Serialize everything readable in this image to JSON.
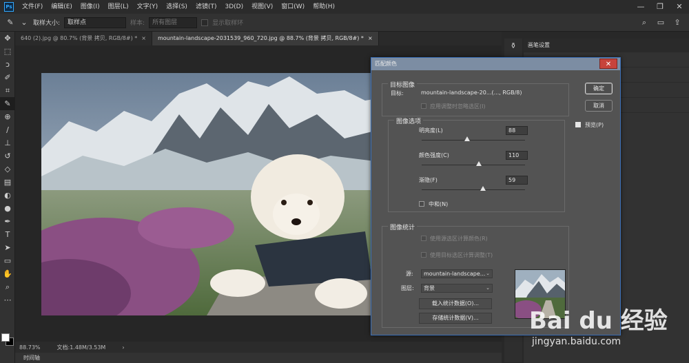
{
  "menubar": {
    "logo": "Ps",
    "items": [
      "文件(F)",
      "编辑(E)",
      "图像(I)",
      "图层(L)",
      "文字(Y)",
      "选择(S)",
      "滤镜(T)",
      "3D(D)",
      "视图(V)",
      "窗口(W)",
      "帮助(H)"
    ],
    "min": "—",
    "max": "❐",
    "close": "✕"
  },
  "options": {
    "size_label": "取样大小:",
    "size_value": "取样点",
    "sample_label": "样本:",
    "sample_value": "所有图层",
    "ring_label": "显示取样环"
  },
  "tabs": [
    {
      "label": "640 (2).jpg @ 80.7% (背景 拷贝, RGB/8#) *",
      "close": "×"
    },
    {
      "label": "mountain-landscape-2031539_960_720.jpg @ 88.7% (背景 拷贝, RGB/8#) *",
      "close": "×"
    }
  ],
  "status": {
    "zoom": "88.73%",
    "doc": "文档:1.48M/3.53M",
    "arrow": "›"
  },
  "timeline": {
    "label": "时间轴"
  },
  "panel": {
    "header": "画笔设置"
  },
  "dialog": {
    "title": "匹配颜色",
    "close": "✕",
    "target_group": "目标图像",
    "target_label": "目标:",
    "target_value": "mountain-landscape-20...(..., RGB/8)",
    "ignore_selection": "应用调整时忽略选区(I)",
    "options_group": "图像选项",
    "luminance_label": "明亮度(L)",
    "luminance_value": "88",
    "intensity_label": "颜色强度(C)",
    "intensity_value": "110",
    "fade_label": "渐隐(F)",
    "fade_value": "59",
    "neutralize_label": "中和(N)",
    "stats_group": "图像统计",
    "use_source_sel": "使用源选区计算颜色(R)",
    "use_target_sel": "使用目标选区计算调整(T)",
    "source_label": "源:",
    "source_value": "mountain-landscape...",
    "layer_label": "图层:",
    "layer_value": "背景",
    "load_stats": "载入统计数据(O)...",
    "save_stats": "存储统计数据(V)...",
    "ok": "确定",
    "cancel": "取消",
    "preview": "预览(P)"
  },
  "sliders": {
    "luminance": 0.44,
    "intensity": 0.55,
    "fade": 0.59
  },
  "watermark": {
    "brand": "Bai du 经验",
    "url": "jingyan.baidu.com"
  }
}
